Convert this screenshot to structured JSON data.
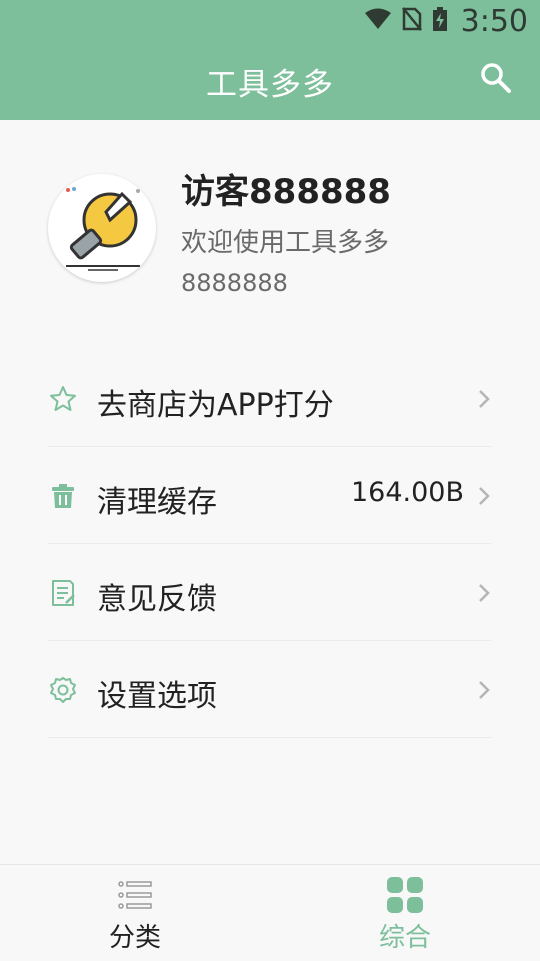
{
  "status": {
    "time": "3:50"
  },
  "appbar": {
    "title": "工具多多",
    "search_icon": "search-icon"
  },
  "profile": {
    "name": "访客888888",
    "welcome": "欢迎使用工具多多",
    "id": "8888888"
  },
  "menu": [
    {
      "icon": "star-icon",
      "label": "去商店为APP打分",
      "value": ""
    },
    {
      "icon": "trash-icon",
      "label": "清理缓存",
      "value": "164.00B"
    },
    {
      "icon": "feedback-icon",
      "label": "意见反馈",
      "value": ""
    },
    {
      "icon": "gear-icon",
      "label": "设置选项",
      "value": ""
    }
  ],
  "bottom_nav": [
    {
      "icon": "list-icon",
      "label": "分类",
      "selected": false
    },
    {
      "icon": "grid-icon",
      "label": "综合",
      "selected": true
    }
  ],
  "colors": {
    "accent": "#7dbf9b",
    "text": "#222222",
    "subtext": "#6a6a6a"
  }
}
